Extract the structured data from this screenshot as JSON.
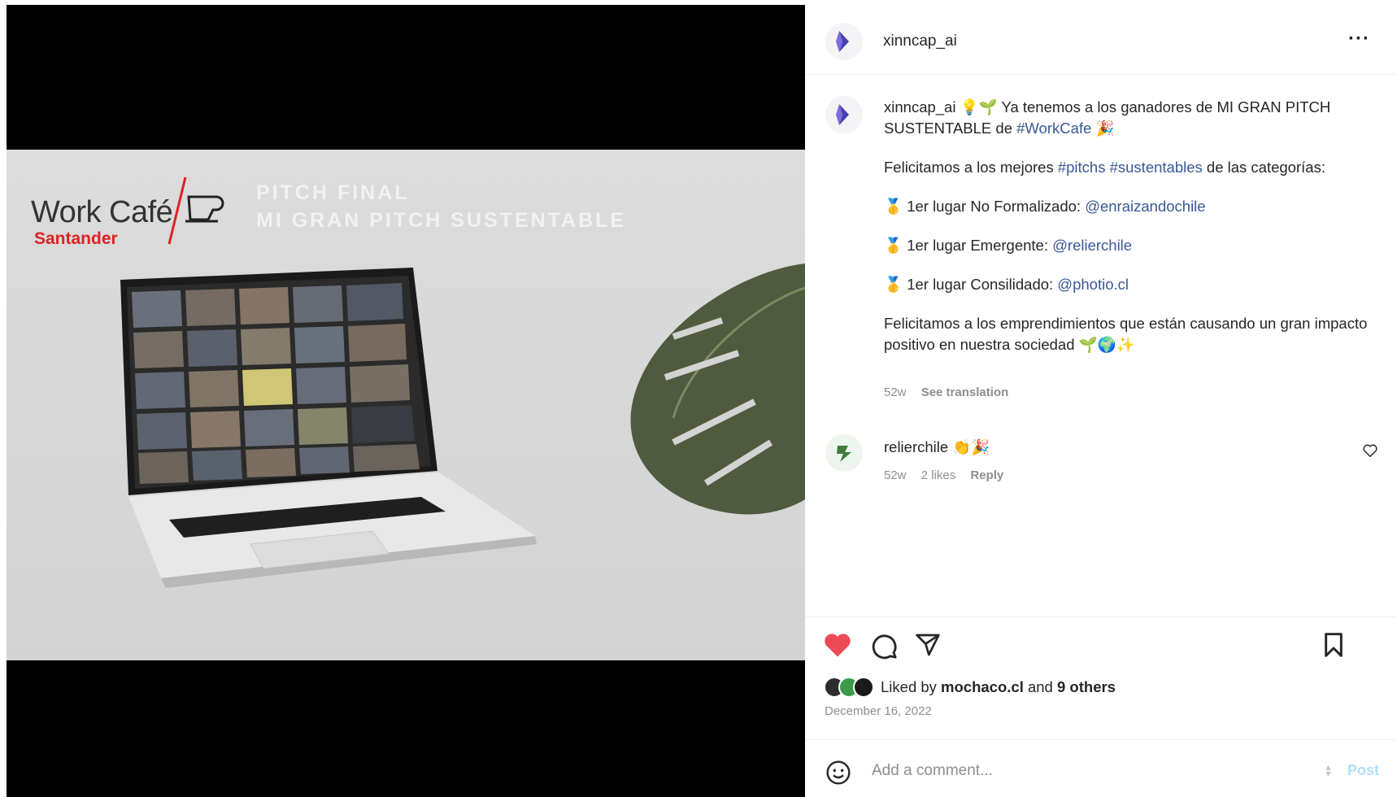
{
  "media": {
    "brand_work": "Work Café",
    "brand_sub": "Santander",
    "pitch_line1": "PITCH FINAL",
    "pitch_line2": "MI GRAN PITCH SUSTENTABLE"
  },
  "header": {
    "username": "xinncap_ai",
    "more_label": "···"
  },
  "caption": {
    "username": "xinncap_ai",
    "line1_text": "Ya tenemos a los ganadores de MI GRAN PITCH SUSTENTABLE de",
    "line1_tag": "#WorkCafe",
    "p2_pre": "Felicitamos a los mejores",
    "p2_tag1": "#pitchs",
    "p2_tag2": "#sustentables",
    "p2_post": "de las categorías:",
    "winners": [
      {
        "label": "1er lugar No Formalizado:",
        "handle": "@enraizandochile"
      },
      {
        "label": "1er lugar Emergente:",
        "handle": "@relierchile"
      },
      {
        "label": "1er lugar Consilidado:",
        "handle": "@photio.cl"
      }
    ],
    "closing": "Felicitamos a los emprendimientos que están causando un gran impacto positivo en nuestra sociedad",
    "age": "52w",
    "see_translation": "See translation"
  },
  "comment": {
    "username": "relierchile",
    "age": "52w",
    "likes": "2 likes",
    "reply": "Reply"
  },
  "likes": {
    "prefix": "Liked by",
    "user": "mochaco.cl",
    "and": "and",
    "others": "9 others"
  },
  "date": "December 16, 2022",
  "comment_bar": {
    "placeholder": "Add a comment...",
    "post_label": "Post"
  },
  "colors": {
    "like_red": "#ed4956",
    "link_blue": "#385898",
    "post_disabled": "#b2dffc",
    "brand_red": "#dd2222"
  },
  "icons": [
    "xinncap-logo-icon",
    "more-icon",
    "medal-icon",
    "heart-icon",
    "comment-icon",
    "share-icon",
    "bookmark-icon",
    "emoji-icon"
  ]
}
